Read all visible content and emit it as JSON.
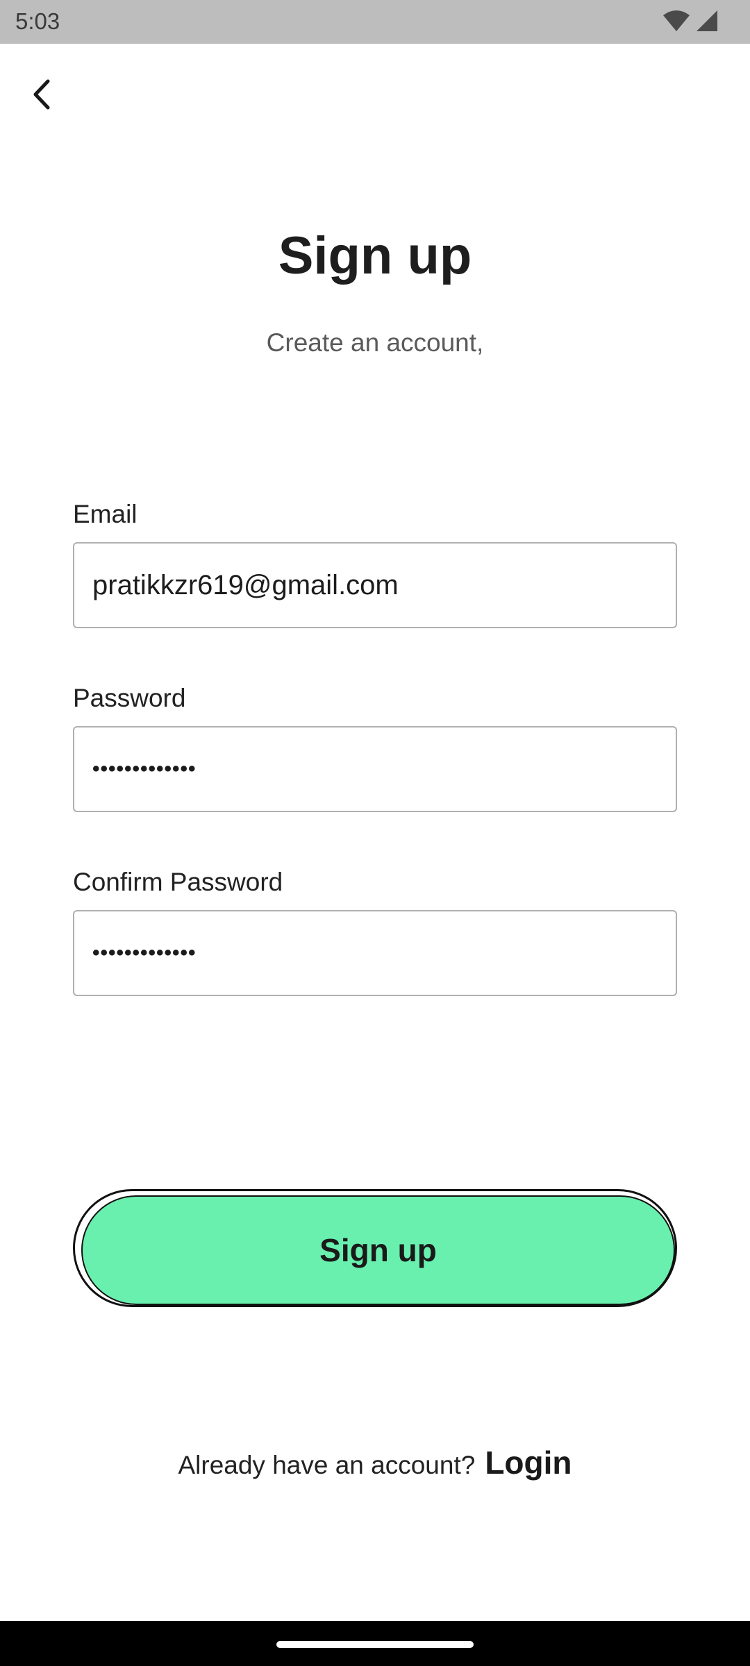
{
  "status_bar": {
    "time": "5:03",
    "icons": [
      "wifi-icon",
      "cellular-signal-icon"
    ]
  },
  "header": {
    "back_icon": "chevron-left-icon"
  },
  "title": "Sign up",
  "subtitle": "Create an account,",
  "form": {
    "email": {
      "label": "Email",
      "value": "pratikkzr619@gmail.com"
    },
    "password": {
      "label": "Password",
      "value": "•••••••••••••"
    },
    "confirm_password": {
      "label": "Confirm Password",
      "value": "•••••••••••••"
    }
  },
  "signup_button": {
    "label": "Sign up",
    "color": "#69f0ae"
  },
  "footer": {
    "prompt": "Already have an account?",
    "login_label": "Login"
  }
}
